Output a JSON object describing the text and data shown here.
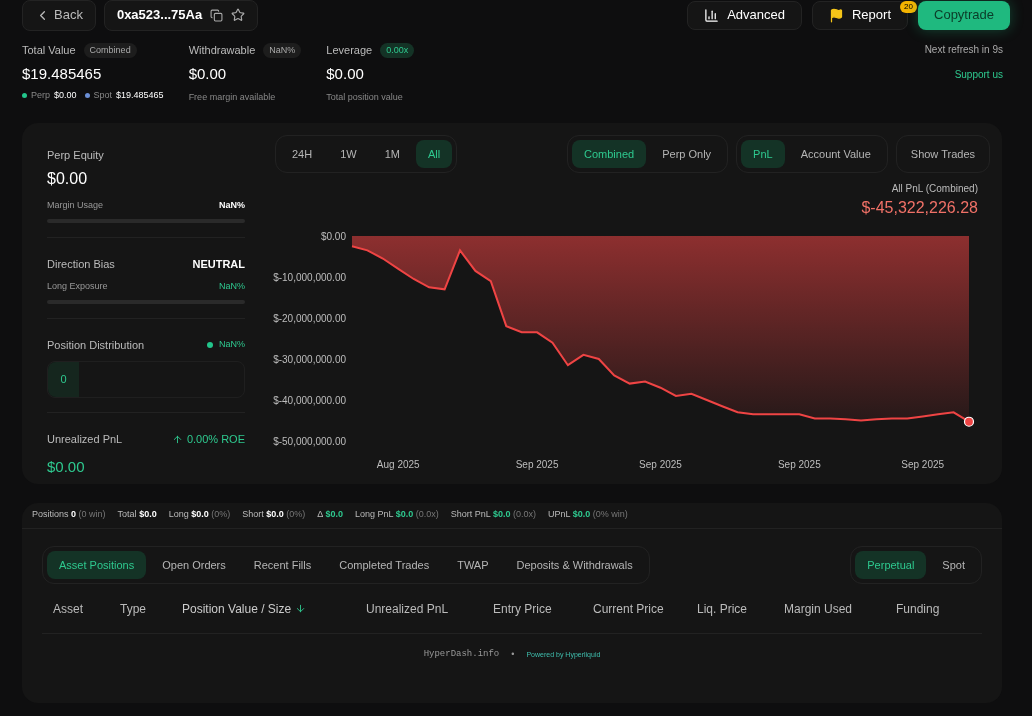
{
  "header": {
    "back": "Back",
    "address": "0xa523...75Aa",
    "buttons": [
      {
        "kind": "chart",
        "label": "Advanced"
      },
      {
        "kind": "flag",
        "label": "Report",
        "badge": "20"
      },
      {
        "kind": "primary",
        "label": "Copytrade"
      }
    ]
  },
  "summary": [
    {
      "label": "Total Value",
      "tag": "Combined",
      "tag_highlighted": false,
      "value": "$19.485465",
      "breakdown": [
        {
          "label": "Perp",
          "value": "$0.00",
          "color": "#22c58b"
        },
        {
          "label": "Spot",
          "value": "$19.485465",
          "color": "#6b8fd6"
        }
      ]
    },
    {
      "label": "Withdrawable",
      "tag": "NaN%",
      "tag_highlighted": false,
      "value": "$0.00",
      "note": "Free margin available"
    },
    {
      "label": "Leverage",
      "tag": "0.00x",
      "tag_highlighted": true,
      "value": "$0.00",
      "note": "Total position value"
    }
  ],
  "refresh": "Next refresh in 9s",
  "support": "Support us",
  "side": {
    "equity_label": "Perp Equity",
    "equity": "$0.00",
    "margin_label": "Margin Usage",
    "margin_value": "NaN%",
    "bias_label": "Direction Bias",
    "bias": "NEUTRAL",
    "exposure_label": "Long Exposure",
    "exposure_value": "NaN%",
    "dist_label": "Position Distribution",
    "dist_value": "NaN%",
    "dist_count": "0",
    "upnl_label": "Unrealized PnL",
    "roe": "0.00% ROE",
    "upnl": "$0.00"
  },
  "ranges": [
    {
      "label": "24H",
      "selected": false
    },
    {
      "label": "1W",
      "selected": false
    },
    {
      "label": "1M",
      "selected": false
    },
    {
      "label": "All",
      "selected": true
    }
  ],
  "modes": [
    {
      "label": "Combined",
      "selected": true
    },
    {
      "label": "Perp Only",
      "selected": false
    }
  ],
  "metrics": [
    {
      "label": "PnL",
      "selected": true
    },
    {
      "label": "Account Value",
      "selected": false
    }
  ],
  "show_trades": "Show Trades",
  "chart_title": "All PnL (Combined)",
  "chart_total": "$-45,322,226.28",
  "chart_data": {
    "type": "area",
    "categories": [
      null,
      null,
      null,
      "Aug 2025",
      null,
      null,
      null,
      null,
      null,
      null,
      null,
      null,
      "Sep 2025",
      null,
      null,
      null,
      null,
      null,
      null,
      null,
      "Sep 2025",
      null,
      null,
      null,
      null,
      null,
      null,
      null,
      null,
      "Sep 2025",
      null,
      null,
      null,
      null,
      null,
      null,
      null,
      "Sep 2025",
      null,
      null,
      null
    ],
    "series": [
      {
        "color": "#ef4444",
        "values": [
          -2500000,
          -3500000,
          -5500000,
          -8000000,
          -10500000,
          -12500000,
          -13000000,
          -3500000,
          -8500000,
          -11000000,
          -22000000,
          -23500000,
          -23500000,
          -26000000,
          -31500000,
          -29000000,
          -30000000,
          -34000000,
          -36000000,
          -35500000,
          -37000000,
          -39000000,
          -38500000,
          -40000000,
          -41500000,
          -43000000,
          -43500000,
          -43500000,
          -43500000,
          -43500000,
          -44500000,
          -44500000,
          -44700000,
          -45000000,
          -44700000,
          -44500000,
          -44500000,
          -44000000,
          -43500000,
          -43000000,
          -45300000
        ]
      }
    ],
    "ylim": [
      -50000000,
      0
    ],
    "yticks": [
      {
        "value": 0,
        "label": "$0.00"
      },
      {
        "value": -10000000,
        "label": "$-10,000,000.00"
      },
      {
        "value": -20000000,
        "label": "$-20,000,000.00"
      },
      {
        "value": -30000000,
        "label": "$-30,000,000.00"
      },
      {
        "value": -40000000,
        "label": "$-40,000,000.00"
      },
      {
        "value": -50000000,
        "label": "$-50,000,000.00"
      }
    ]
  },
  "stats": [
    {
      "label": "Positions",
      "value": "0",
      "positive": false,
      "note": "(0 win)"
    },
    {
      "label": "Total",
      "value": "$0.0",
      "positive": false
    },
    {
      "label": "Long",
      "value": "$0.0",
      "positive": false,
      "note": "(0%)"
    },
    {
      "label": "Short",
      "value": "$0.0",
      "positive": false,
      "note": "(0%)"
    },
    {
      "label": "Δ",
      "value": "$0.0",
      "positive": true
    },
    {
      "label": "Long PnL",
      "value": "$0.0",
      "positive": true,
      "note": "(0.0x)"
    },
    {
      "label": "Short PnL",
      "value": "$0.0",
      "positive": true,
      "note": "(0.0x)"
    },
    {
      "label": "UPnL",
      "value": "$0.0",
      "positive": true,
      "note": "(0% win)"
    }
  ],
  "tabs": [
    {
      "label": "Asset Positions",
      "selected": true
    },
    {
      "label": "Open Orders",
      "selected": false
    },
    {
      "label": "Recent Fills",
      "selected": false
    },
    {
      "label": "Completed Trades",
      "selected": false
    },
    {
      "label": "TWAP",
      "selected": false
    },
    {
      "label": "Deposits & Withdrawals",
      "selected": false
    }
  ],
  "markets": [
    {
      "label": "Perpetual",
      "selected": true
    },
    {
      "label": "Spot",
      "selected": false
    }
  ],
  "table": {
    "columns": [
      {
        "label": "Asset",
        "sorted": false
      },
      {
        "label": "Type",
        "sorted": false
      },
      {
        "label": "Position Value / Size",
        "sorted": true
      },
      {
        "label": "Unrealized PnL",
        "sorted": false
      },
      {
        "label": "Entry Price",
        "sorted": false
      },
      {
        "label": "Current Price",
        "sorted": false
      },
      {
        "label": "Liq. Price",
        "sorted": false
      },
      {
        "label": "Margin Used",
        "sorted": false
      },
      {
        "label": "Funding",
        "sorted": false
      }
    ]
  },
  "footer": {
    "site": "HyperDash.info",
    "separator": "•",
    "powered": "Powered by Hyperliquid"
  }
}
